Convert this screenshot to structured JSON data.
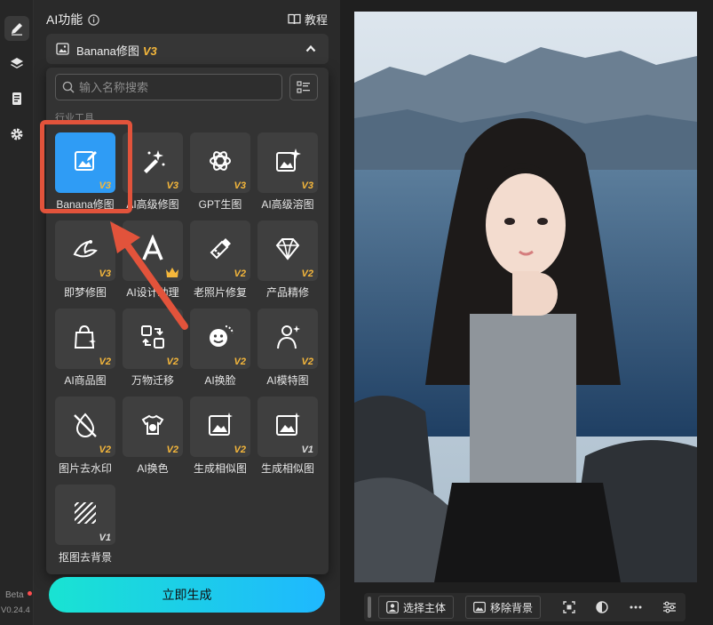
{
  "sidebar": {
    "beta": "Beta",
    "version": "V0.24.4"
  },
  "panel": {
    "title": "AI功能",
    "tutorial": "教程",
    "selected_tool": "Banana修图",
    "selected_version": "V3",
    "search_placeholder": "输入名称搜索",
    "category": "行业工具",
    "tools": [
      {
        "label": "Banana修图",
        "tag": "V3",
        "icon": "edit-image-icon"
      },
      {
        "label": "AI高级修图",
        "tag": "V3",
        "icon": "magic-wand-icon"
      },
      {
        "label": "GPT生图",
        "tag": "V3",
        "icon": "gpt-logo-icon"
      },
      {
        "label": "AI高级溶图",
        "tag": "V3",
        "icon": "image-sparkle-icon"
      },
      {
        "label": "即梦修图",
        "tag": "V3",
        "icon": "jimeng-icon"
      },
      {
        "label": "AI设计助理",
        "tag": "",
        "icon": "design-assistant-icon"
      },
      {
        "label": "老照片修复",
        "tag": "V2",
        "icon": "photo-repair-icon"
      },
      {
        "label": "产品精修",
        "tag": "V2",
        "icon": "diamond-icon"
      },
      {
        "label": "AI商品图",
        "tag": "V2",
        "icon": "shopping-bag-icon"
      },
      {
        "label": "万物迁移",
        "tag": "V2",
        "icon": "transfer-icon"
      },
      {
        "label": "AI换脸",
        "tag": "V2",
        "icon": "face-swap-icon"
      },
      {
        "label": "AI模特图",
        "tag": "V2",
        "icon": "model-icon"
      },
      {
        "label": "图片去水印",
        "tag": "V2",
        "icon": "remove-watermark-icon"
      },
      {
        "label": "AI换色",
        "tag": "V2",
        "icon": "palette-icon"
      },
      {
        "label": "生成相似图",
        "tag": "V2",
        "icon": "similar-image-icon"
      },
      {
        "label": "生成相似图",
        "tag": "V1",
        "icon": "similar-image-icon"
      },
      {
        "label": "抠图去背景",
        "tag": "V1",
        "icon": "cutout-icon"
      }
    ],
    "generate_button": "立即生成"
  },
  "toolbar": {
    "select_subject": "选择主体",
    "remove_background": "移除背景"
  },
  "colors": {
    "accent": "#2f9cf5",
    "version_tag": "#f5b73b",
    "highlight": "#e2533b",
    "button_from": "#19e3d2",
    "button_to": "#1fb8ff"
  }
}
